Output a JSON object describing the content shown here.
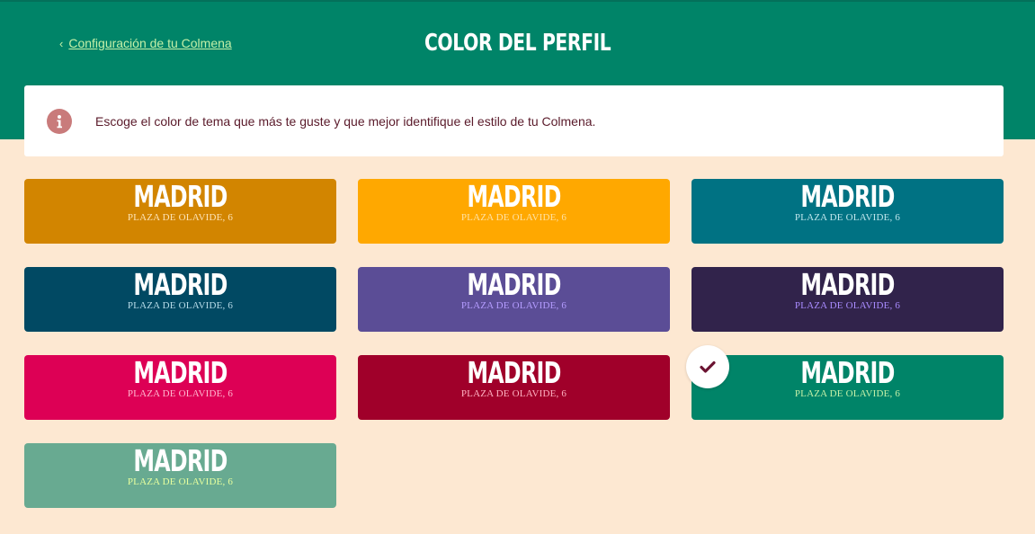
{
  "header": {
    "back_link": "Configuración de tu Colmena",
    "title": "COLOR DEL PERFIL"
  },
  "info": {
    "text": "Escoge el color de tema que más te guste y que mejor identifique el estilo de tu Colmena."
  },
  "cards": [
    {
      "city": "MADRID",
      "address": "PLAZA DE OLAVIDE, 6",
      "bg": "#d28500",
      "addr_color": "#fde3b5",
      "selected": false
    },
    {
      "city": "MADRID",
      "address": "PLAZA DE OLAVIDE, 6",
      "bg": "#ffa800",
      "addr_color": "#ffe2a3",
      "selected": false
    },
    {
      "city": "MADRID",
      "address": "PLAZA DE OLAVIDE, 6",
      "bg": "#007283",
      "addr_color": "#bfe6ec",
      "selected": false
    },
    {
      "city": "MADRID",
      "address": "PLAZA DE OLAVIDE, 6",
      "bg": "#014963",
      "addr_color": "#b7dbe8",
      "selected": false
    },
    {
      "city": "MADRID",
      "address": "PLAZA DE OLAVIDE, 6",
      "bg": "#5b4d96",
      "addr_color": "#b49cff",
      "selected": false
    },
    {
      "city": "MADRID",
      "address": "PLAZA DE OLAVIDE, 6",
      "bg": "#31234b",
      "addr_color": "#a98cff",
      "selected": false
    },
    {
      "city": "MADRID",
      "address": "PLAZA DE OLAVIDE, 6",
      "bg": "#dd0055",
      "addr_color": "#ffb7cf",
      "selected": false
    },
    {
      "city": "MADRID",
      "address": "PLAZA DE OLAVIDE, 6",
      "bg": "#a0002a",
      "addr_color": "#ffb3c2",
      "selected": false
    },
    {
      "city": "MADRID",
      "address": "PLAZA DE OLAVIDE, 6",
      "bg": "#008468",
      "addr_color": "#c5f0a8",
      "selected": true
    },
    {
      "city": "MADRID",
      "address": "PLAZA DE OLAVIDE, 6",
      "bg": "#68aa91",
      "addr_color": "#e6ff9e",
      "selected": false
    }
  ],
  "icons": {
    "back": "chevron-left-icon",
    "info": "info-icon",
    "selected": "checkmark-icon"
  },
  "colors": {
    "header_bg": "#008468",
    "page_bg": "#fde8d2",
    "info_icon_bg": "#c97b7b",
    "check_color": "#6b1432"
  }
}
